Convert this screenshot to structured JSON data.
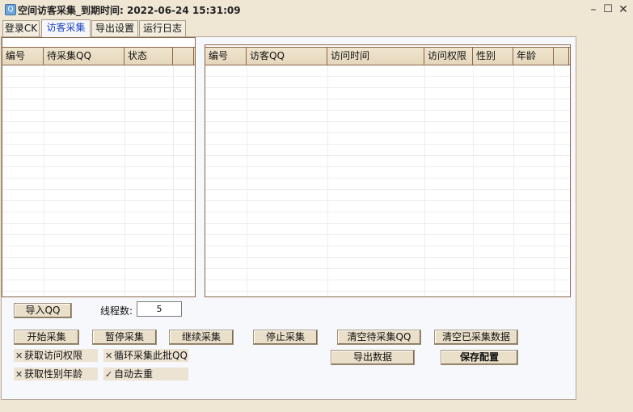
{
  "window": {
    "title": "空间访客采集_到期时间: 2022-06-24 15:31:09",
    "app_icon_glyph": "Q"
  },
  "tabs": [
    {
      "label": "登录CK",
      "active": false
    },
    {
      "label": "访客采集",
      "active": true
    },
    {
      "label": "导出设置",
      "active": false
    },
    {
      "label": "运行日志",
      "active": false
    }
  ],
  "left_table": {
    "columns": [
      "编号",
      "待采集QQ",
      "状态",
      ""
    ],
    "rows": []
  },
  "right_table": {
    "columns": [
      "编号",
      "访客QQ",
      "访问时间",
      "访问权限",
      "性别",
      "年龄",
      ""
    ],
    "rows": []
  },
  "controls": {
    "import_qq": "导入QQ",
    "thread_label": "线程数:",
    "thread_value": "5",
    "start": "开始采集",
    "pause": "暂停采集",
    "resume": "继续采集",
    "stop": "停止采集",
    "clear_pending": "清空待采集QQ",
    "clear_collected": "清空已采集数据",
    "export": "导出数据",
    "save_config": "保存配置"
  },
  "options": [
    {
      "label": "获取访问权限",
      "checked": false
    },
    {
      "label": "循环采集此批QQ",
      "checked": false
    },
    {
      "label": "获取性别年龄",
      "checked": false
    },
    {
      "label": "自动去重",
      "checked": true
    }
  ],
  "colors": {
    "window_bg": "#efe6d4",
    "accent_tab": "#1a45c5",
    "grid_border": "#8a6748"
  }
}
